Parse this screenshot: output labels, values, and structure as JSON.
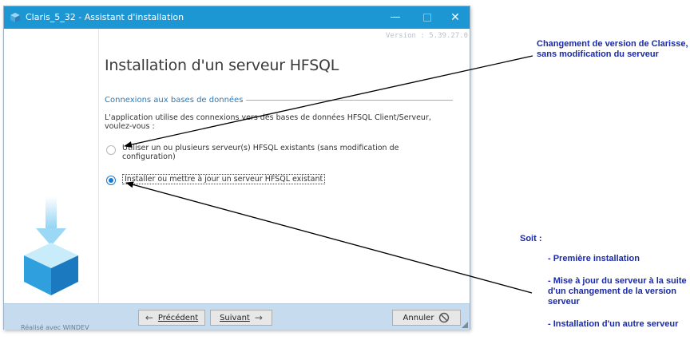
{
  "window": {
    "title": "Claris_5_32 - Assistant d'installation",
    "minimize_glyph": "—",
    "close_glyph": "✕",
    "version": "Version : 5.39.27.0"
  },
  "main": {
    "heading": "Installation d'un serveur HFSQL",
    "section_title": "Connexions aux bases de données",
    "description": "L'application utilise des connexions vers des bases de données HFSQL Client/Serveur, voulez-vous :",
    "options": [
      {
        "label": "Utiliser un ou plusieurs serveur(s) HFSQL existants (sans modification de configuration)",
        "selected": false
      },
      {
        "label": "Installer ou mettre à jour un serveur HFSQL existant",
        "selected": true
      }
    ]
  },
  "footer": {
    "credit": "Réalisé avec WINDEV",
    "prev_label": "Précédent",
    "next_label": "Suivant",
    "cancel_label": "Annuler"
  },
  "annotations": {
    "top_note": "Changement de version de Clarisse, sans modification du serveur",
    "soit": "Soit :",
    "items": [
      "- Première installation",
      "- Mise à jour du serveur à la suite d'un changement de la version serveur",
      "- Installation d'un autre serveur"
    ],
    "color": "#1a2aa8"
  },
  "colors": {
    "titlebar": "#1c97d4",
    "footer": "#c6dcee",
    "accent": "#2b7ab8"
  },
  "icons": {
    "app": "box-icon",
    "logo": "install-arrow-box-icon",
    "prev": "arrow-left-icon",
    "next": "arrow-right-icon",
    "cancel": "cancel-icon"
  }
}
